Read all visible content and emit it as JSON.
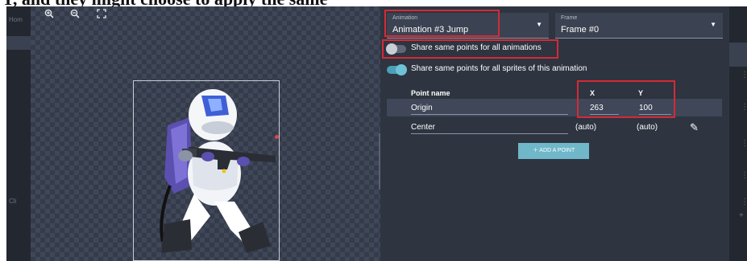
{
  "caption": "Y, and they might choose to apply the same",
  "sidebar": {
    "home_label": "Hom",
    "left_label": "Cli"
  },
  "toolbar": {
    "zoom_in_icon": "zoom-in-icon",
    "zoom_out_icon": "zoom-out-icon",
    "fit_icon": "fit-to-screen-icon"
  },
  "animation_select": {
    "label": "Animation",
    "value": "Animation #3 Jump"
  },
  "frame_select": {
    "label": "Frame",
    "value": "Frame #0"
  },
  "toggles": [
    {
      "label": "Share same points for all animations",
      "on": false
    },
    {
      "label": "Share same points for all sprites of this animation",
      "on": true
    }
  ],
  "table": {
    "headers": {
      "name": "Point name",
      "x": "X",
      "y": "Y"
    },
    "rows": [
      {
        "name": "Origin",
        "x": "263",
        "y": "100"
      },
      {
        "name": "Center",
        "x": "(auto)",
        "y": "(auto)"
      }
    ]
  },
  "add_point_label": "ADD A POINT",
  "colors": {
    "highlight": "#d52a35",
    "accent": "#6fb7c9",
    "panel": "#2e3440"
  }
}
